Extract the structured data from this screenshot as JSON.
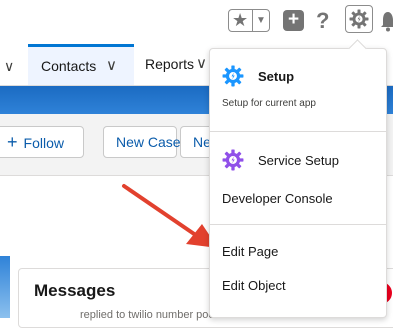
{
  "global_header": {
    "favorites_icon": "star-icon",
    "favorites_dropdown_icon": "caret-down-icon",
    "add_icon": "plus-icon",
    "help_icon": "question-icon",
    "setup_icon": "gear-icon",
    "notifications_icon": "bell-icon"
  },
  "nav": {
    "tabs": [
      {
        "label": "Contacts",
        "active": true
      },
      {
        "label": "Reports",
        "active": false
      }
    ]
  },
  "actions": {
    "follow_plus": "+",
    "follow_label": "Follow",
    "new_case_label": "New Case",
    "truncated_label": "Ne"
  },
  "card": {
    "title": "Messages",
    "subtitle": "replied to twilio number pool"
  },
  "setup_menu": {
    "items": [
      {
        "label": "Setup",
        "sublabel": "Setup for current app",
        "icon": "setup-gear-icon"
      },
      {
        "label": "Service Setup",
        "icon": "service-setup-gear-icon"
      },
      {
        "label": "Developer Console"
      },
      {
        "label": "Edit Page"
      },
      {
        "label": "Edit Object"
      }
    ]
  },
  "colors": {
    "brand_blue": "#0176d3",
    "setup_icon_blue": "#1b96ff",
    "service_icon_purple": "#9050e9",
    "arrow_red": "#e2412e"
  }
}
